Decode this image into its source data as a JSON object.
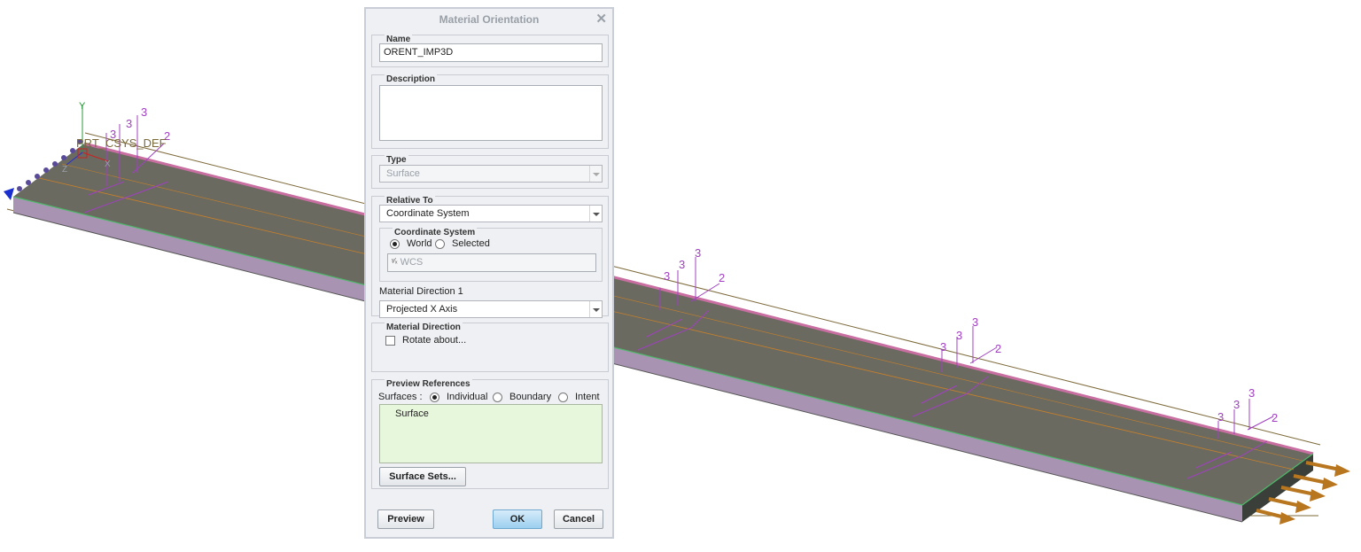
{
  "model": {
    "csys_label": "PRT_CSYS_DEF",
    "axis_y_label": "Y",
    "axis_x_label": "X",
    "axis_z_label": "Z",
    "orientation_numbers": [
      "3",
      "3",
      "2"
    ]
  },
  "dialog": {
    "title": "Material Orientation",
    "close_icon": "close-x",
    "name_group": {
      "title": "Name",
      "value": "ORENT_IMP3D"
    },
    "description_group": {
      "title": "Description",
      "value": ""
    },
    "type_group": {
      "title": "Type",
      "selected": "Surface"
    },
    "relative_group": {
      "title": "Relative To",
      "selected": "Coordinate System",
      "csys_sub": {
        "title": "Coordinate System",
        "world_label": "World",
        "selected_label": "Selected",
        "csys_value": "WCS",
        "csys_icon": "csys-axes-icon"
      },
      "direction1_label": "Material Direction 1",
      "direction1_selected": "Projected X Axis"
    },
    "material_direction_group": {
      "title": "Material Direction",
      "rotate_label": "Rotate about..."
    },
    "preview_group": {
      "title": "Preview References",
      "surfaces_label": "Surfaces :",
      "individual_label": "Individual",
      "boundary_label": "Boundary",
      "intent_label": "Intent",
      "list_items": [
        "Surface"
      ],
      "surface_sets_label": "Surface Sets..."
    },
    "buttons": {
      "preview": "Preview",
      "ok": "OK",
      "cancel": "Cancel"
    }
  }
}
